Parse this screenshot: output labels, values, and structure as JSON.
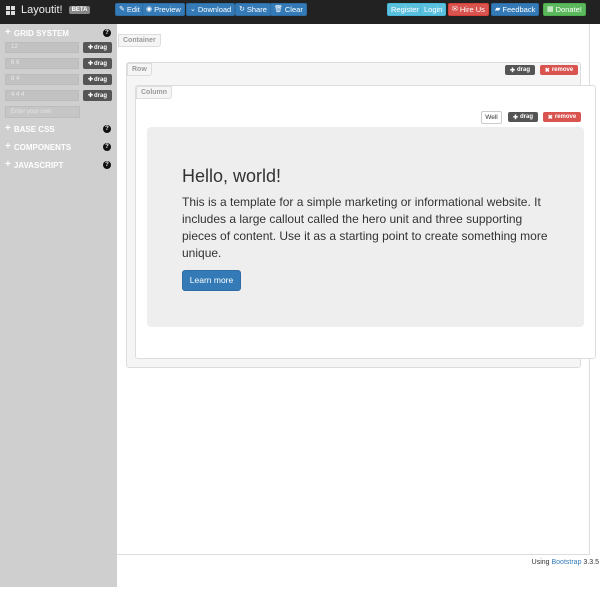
{
  "app": {
    "title": "Layoutit!",
    "badge": "BETA"
  },
  "toolbar": {
    "edit": "Edit",
    "preview": "Preview",
    "download": "Download",
    "share": "Share",
    "clear": "Clear",
    "register": "Register",
    "login": "Login",
    "hire_us": "Hire Us",
    "feedback": "Feedback",
    "donate": "Donate!"
  },
  "sidebar": {
    "grid_system": "GRID SYSTEM",
    "grid_rows": [
      {
        "value": "12",
        "drag": "drag"
      },
      {
        "value": "6 6",
        "drag": "drag"
      },
      {
        "value": "8 4",
        "drag": "drag"
      },
      {
        "value": "4 4 4",
        "drag": "drag"
      }
    ],
    "custom_placeholder": "Enter your own",
    "base_css": "BASE CSS",
    "components": "COMPONENTS",
    "javascript": "JAVASCRIPT"
  },
  "canvas": {
    "container_label": "Container",
    "row_label": "Row",
    "column_label": "Column",
    "well_label": "Well",
    "drag_label": "drag",
    "remove_label": "remove"
  },
  "hero": {
    "heading": "Hello, world!",
    "text": "This is a template for a simple marketing or informational website. It includes a large callout called the hero unit and three supporting pieces of content. Use it as a starting point to create something more unique.",
    "button": "Learn more"
  },
  "footer": {
    "prefix": "Using",
    "link": "Bootstrap",
    "version": "3.3.5"
  },
  "colors": {
    "primary": "#337ab7",
    "info": "#5bc0de",
    "danger": "#d9534f",
    "success": "#5cb85c",
    "navbar": "#222222",
    "sidebar": "#cfcfcf"
  }
}
